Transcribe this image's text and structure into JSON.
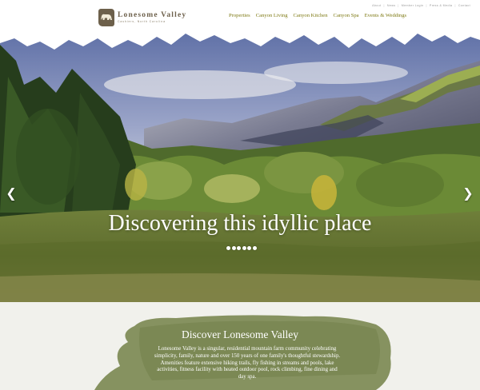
{
  "brand": {
    "name": "Lonesome Valley",
    "tagline": "Cashiers, North Carolina",
    "logo_icon": "bear-icon"
  },
  "utility_nav": [
    "About",
    "News",
    "Member Login",
    "Press & Media",
    "Contact"
  ],
  "main_nav": [
    "Properties",
    "Canyon Living",
    "Canyon Kitchen",
    "Canyon Spa",
    "Events & Weddings"
  ],
  "hero": {
    "title": "Discovering this idyllic place",
    "slide_count": 6,
    "active_slide": 1,
    "prev_icon": "chevron-left-icon",
    "next_icon": "chevron-right-icon"
  },
  "intro": {
    "title": "Discover Lonesome Valley",
    "body": "Lonesome Valley is a singular, residential mountain farm community celebrating simplicity, family, nature and over 150 years of one family's thoughtful stewardship. Amenities feature extensive hiking trails, fly fishing in streams and pools, lake activities, fitness facility with heated outdoor pool, rock climbing, fine dining and day spa."
  },
  "colors": {
    "nav_text": "#7e7a14",
    "brand": "#6d604b",
    "wash_green": "#7d8a54",
    "section_bg": "#f1f1ec"
  }
}
